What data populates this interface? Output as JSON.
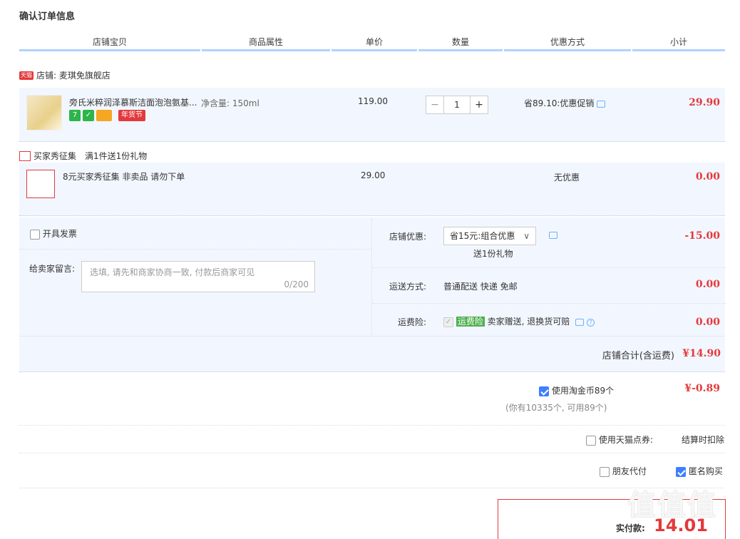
{
  "page_title": "确认订单信息",
  "headers": [
    "店铺宝贝",
    "商品属性",
    "单价",
    "数量",
    "优惠方式",
    "小计"
  ],
  "shop": {
    "badge": "天猫",
    "label": "店铺: 麦琪免旗舰店"
  },
  "item": {
    "name": "旁氏米粹润泽慕斯洁面泡泡氨基...",
    "attr": "净含量: 150ml",
    "price": "119.00",
    "qty": "1",
    "qty_minus": "−",
    "qty_plus": "+",
    "promo": "省89.10:优惠促销",
    "subtotal": "29.90",
    "badge_7": "7",
    "badge_festival": "年货节"
  },
  "gift": {
    "header_name": "买家秀征集",
    "header_rule": "满1件送1份礼物",
    "name": "8元买家秀征集 非卖品 请勿下单",
    "price": "29.00",
    "promo": "无优惠",
    "subtotal": "0.00"
  },
  "invoice_label": "开具发票",
  "message": {
    "label": "给卖家留言:",
    "placeholder": "选填, 请先和商家协商一致, 付款后商家可见",
    "counter": "0/200"
  },
  "shop_discount": {
    "label": "店铺优惠:",
    "selected": "省15元:组合优惠",
    "gift_note": "送1份礼物",
    "amount": "-15.00"
  },
  "shipping": {
    "label": "运送方式:",
    "value": "普通配送 快递 免邮",
    "amount": "0.00"
  },
  "insurance": {
    "label": "运费险:",
    "badge": "运费险",
    "text": "卖家赠送, 退换货可赔",
    "amount": "0.00"
  },
  "shop_total": {
    "label": "店铺合计(含运费)",
    "amount": "¥14.90"
  },
  "coins": {
    "label": "使用淘金币89个",
    "note": "(你有10335个, 可用89个)",
    "amount": "¥-0.89"
  },
  "tmall_points": {
    "label": "使用天猫点券:",
    "value": "结算时扣除"
  },
  "friend_pay": "朋友代付",
  "anonymous": "匿名购买",
  "pay": {
    "label": "实付款:",
    "amount": "14.01"
  },
  "watermark": "值值值"
}
